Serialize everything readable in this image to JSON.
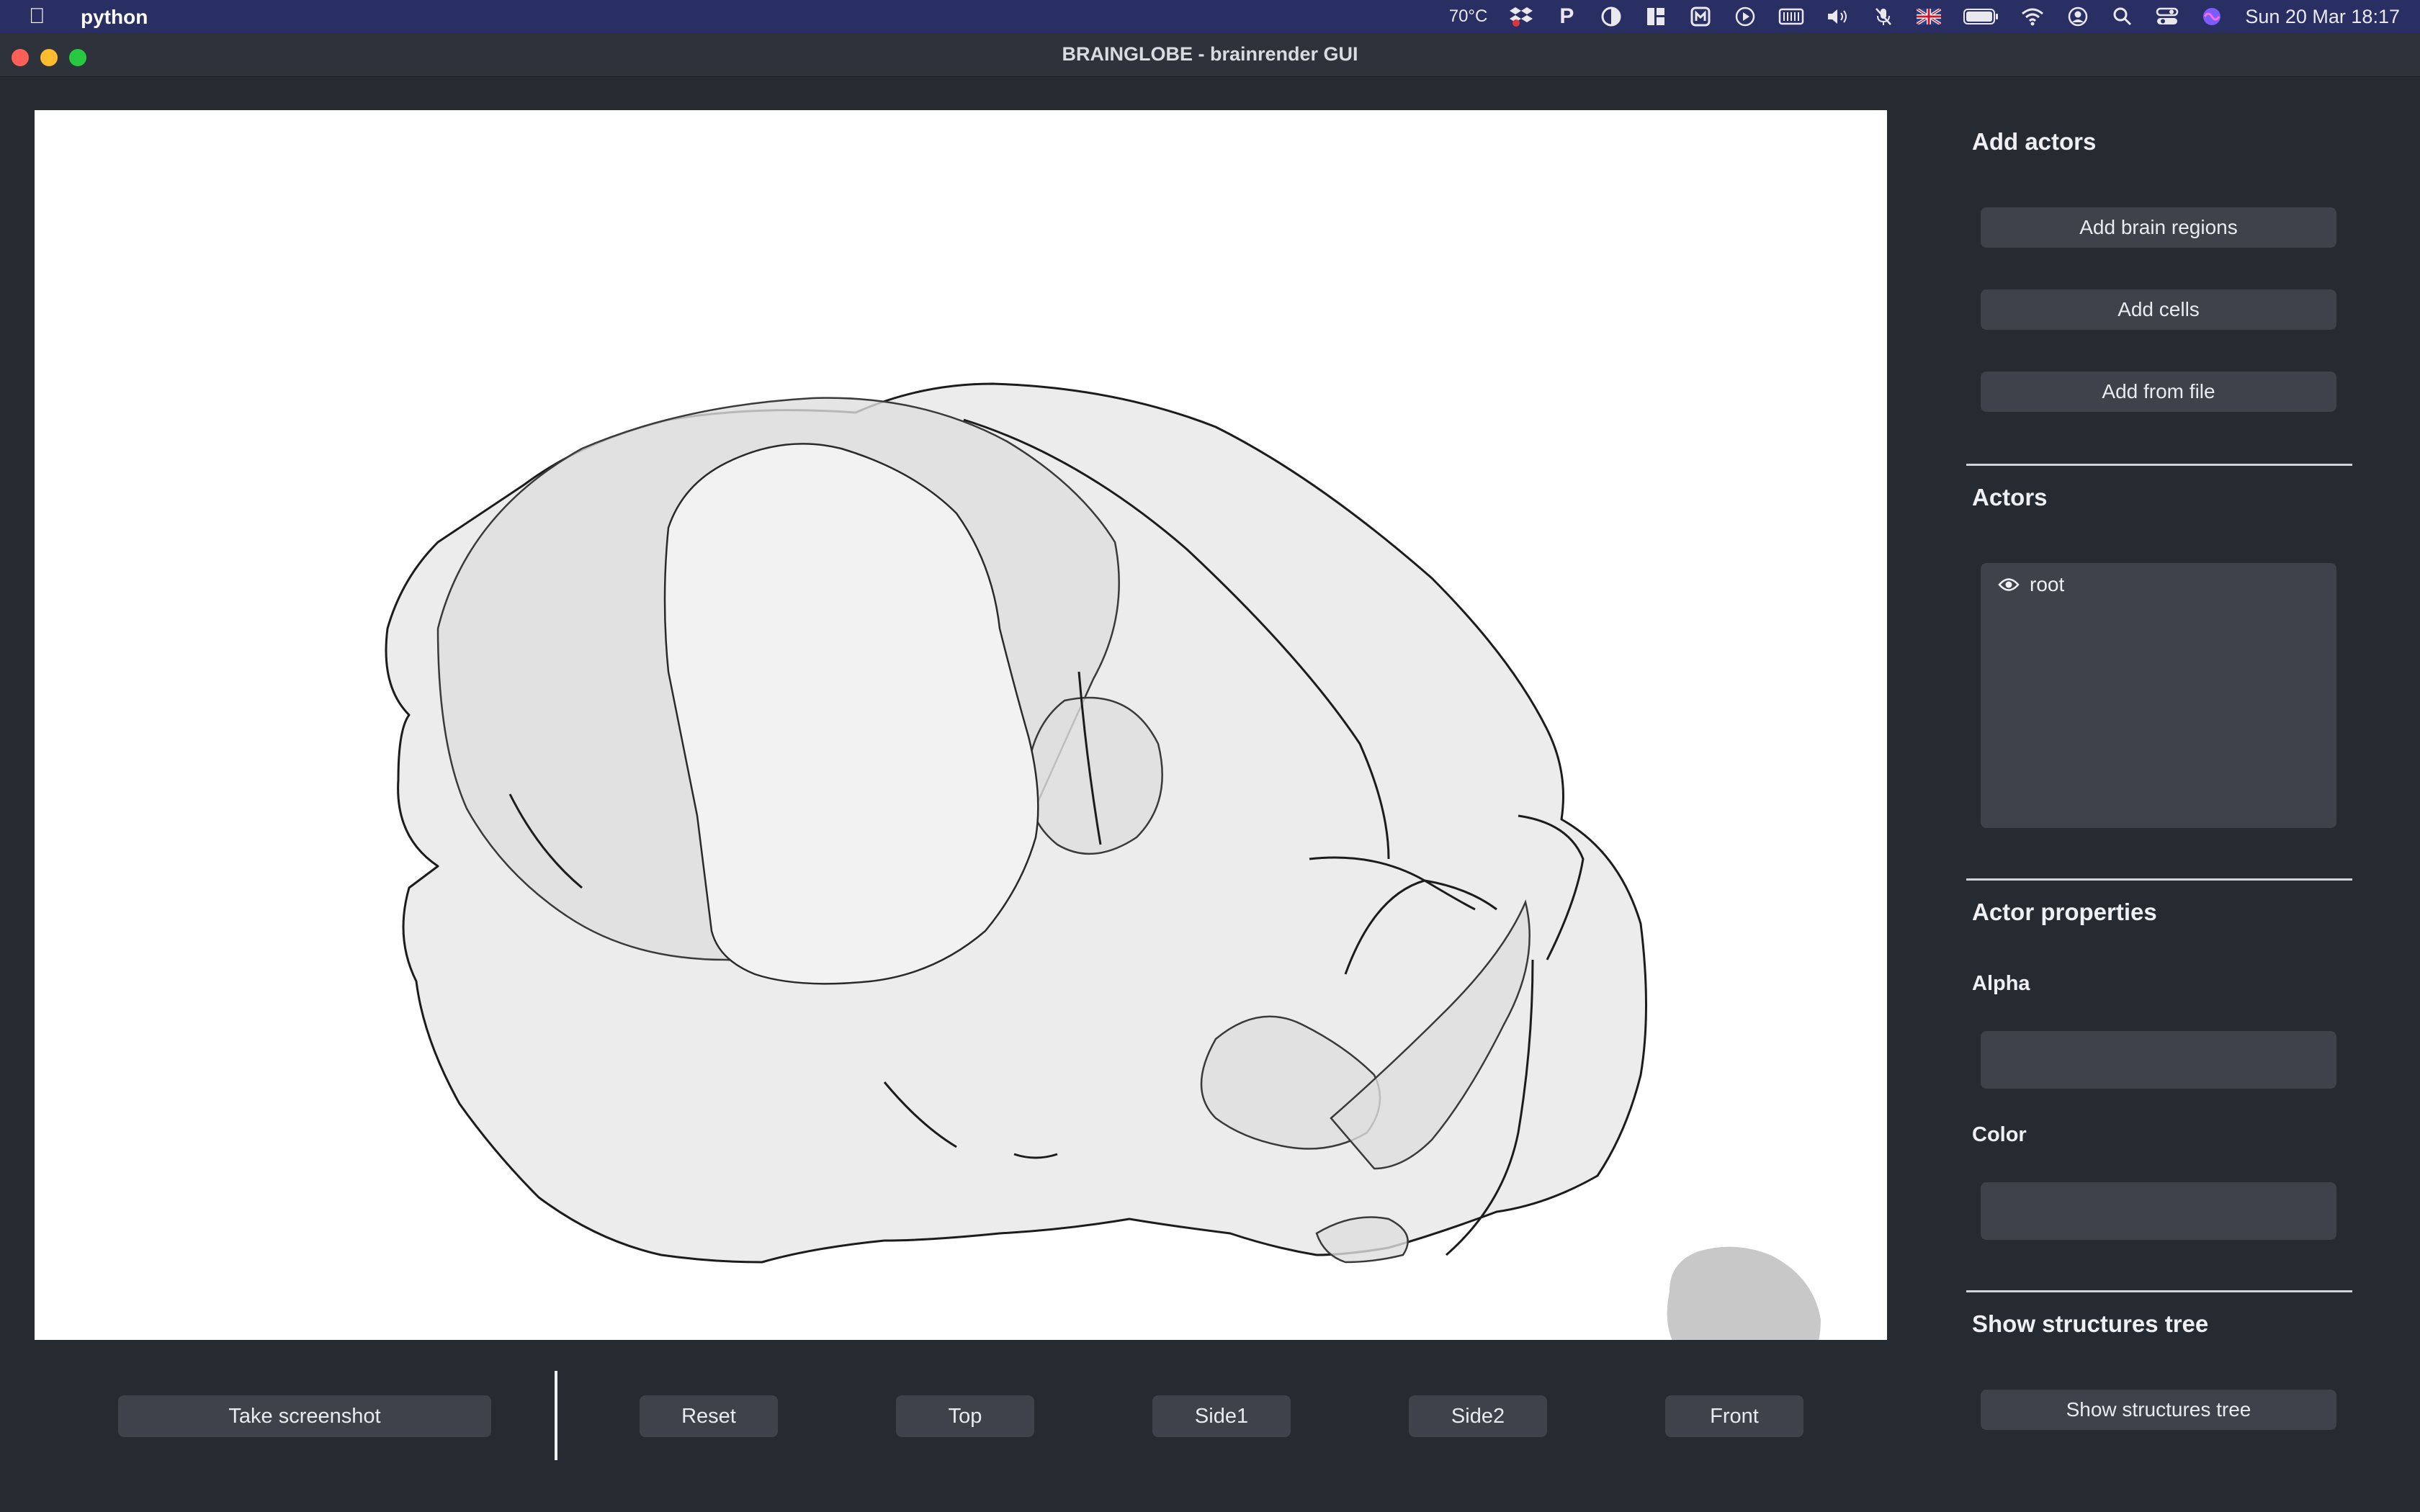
{
  "menubar": {
    "app_name": "python",
    "temperature": "70°C",
    "datetime": "Sun 20 Mar  18:17",
    "status_icons": [
      "dropbox-icon",
      "p-icon",
      "half-circle-icon",
      "grid-icon",
      "m-icon",
      "play-icon",
      "battery-bar-icon",
      "volume-icon",
      "mic-off-icon",
      "uk-flag-icon",
      "battery-icon",
      "wifi-icon",
      "user-icon",
      "search-icon",
      "control-center-icon",
      "siri-icon"
    ]
  },
  "window": {
    "title": "BRAINGLOBE - brainrender GUI"
  },
  "bottom_bar": {
    "screenshot_label": "Take screenshot",
    "reset_label": "Reset",
    "top_label": "Top",
    "side1_label": "Side1",
    "side2_label": "Side2",
    "front_label": "Front"
  },
  "panel": {
    "add_actors_title": "Add actors",
    "add_brain_regions": "Add brain regions",
    "add_cells": "Add cells",
    "add_from_file": "Add from file",
    "actors_title": "Actors",
    "actors": [
      {
        "label": "root",
        "visible": true
      }
    ],
    "actor_properties_title": "Actor properties",
    "alpha_label": "Alpha",
    "alpha_value": "",
    "color_label": "Color",
    "color_value": "",
    "structures_title": "Show structures tree",
    "show_structures_tree": "Show structures tree"
  },
  "colors": {
    "window_bg": "#262a31",
    "button_bg": "#3d424b",
    "menubar_bg": "#2a2f63",
    "viewport_bg": "#ffffff",
    "mesh_fill": "#ececec",
    "mesh_outline": "#1c1c1c"
  }
}
